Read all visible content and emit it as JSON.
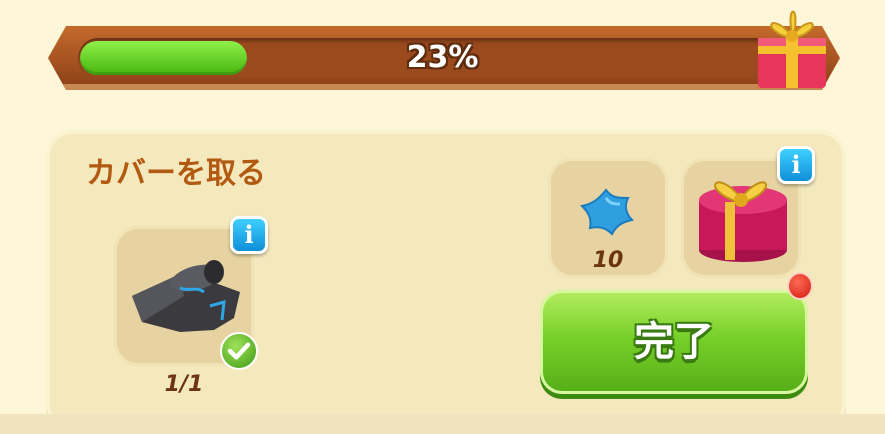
{
  "progress": {
    "fraction": 0.23,
    "label": "23%",
    "reward_icon": "gift-box-icon"
  },
  "task": {
    "title": "カバーを取る",
    "requirement": {
      "icon": "tarp-cover-icon",
      "count": "1/1",
      "completed": true
    }
  },
  "rewards": [
    {
      "icon": "blue-star-icon",
      "count": "10"
    },
    {
      "icon": "gift-box-icon"
    }
  ],
  "done_button": {
    "label": "完了"
  },
  "colors": {
    "accent_green": "#78d02a",
    "info_blue": "#1aa7ea",
    "title_brown": "#b35a12"
  }
}
